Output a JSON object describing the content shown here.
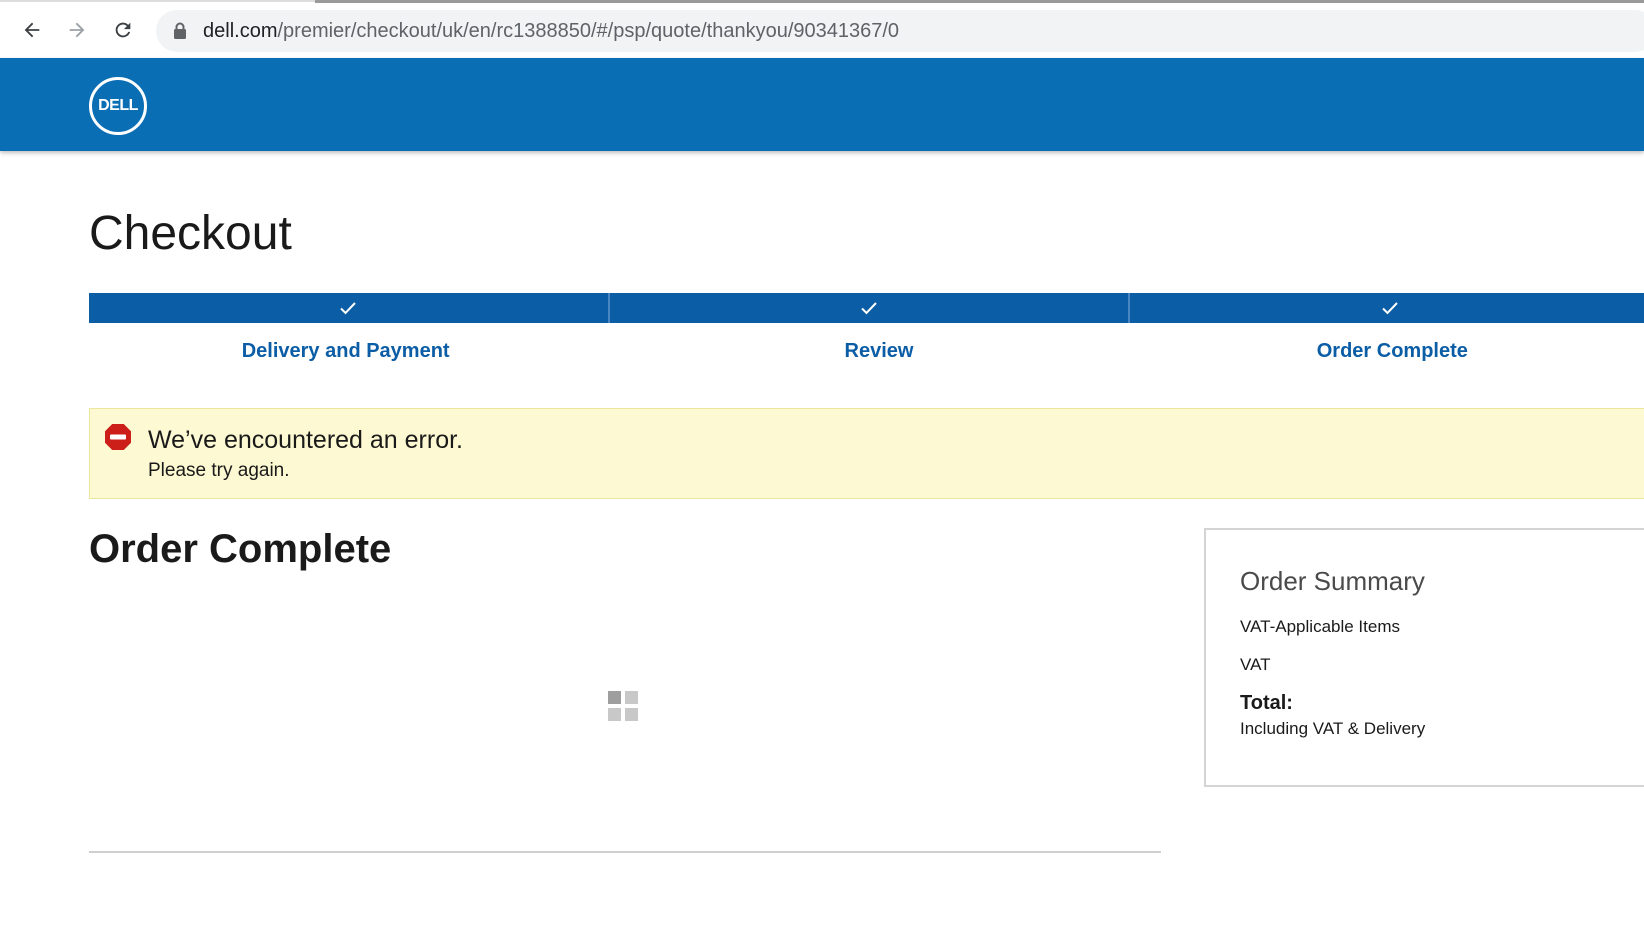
{
  "browser": {
    "url_host": "dell.com",
    "url_path": "/premier/checkout/uk/en/rc1388850/#/psp/quote/thankyou/90341367/0",
    "back_icon": "arrow-left-icon",
    "forward_icon": "arrow-right-icon",
    "reload_icon": "reload-icon",
    "lock_icon": "lock-icon"
  },
  "header": {
    "logo_text": "DELL",
    "brand_color": "#0a6eb4"
  },
  "checkout": {
    "title": "Checkout",
    "steps": [
      {
        "label": "Delivery and Payment",
        "completed": true
      },
      {
        "label": "Review",
        "completed": true
      },
      {
        "label": "Order Complete",
        "completed": true
      }
    ]
  },
  "alert": {
    "icon": "error-stop-icon",
    "title": "We’ve encountered an error.",
    "message": "Please try again.",
    "background": "#fdf9d2"
  },
  "main": {
    "section_title": "Order Complete",
    "loader_icon": "loading-grid-icon"
  },
  "order_summary": {
    "title": "Order Summary",
    "vat_items_label": "VAT-Applicable Items",
    "vat_label": "VAT",
    "total_label": "Total:",
    "total_note": "Including VAT & Delivery"
  }
}
